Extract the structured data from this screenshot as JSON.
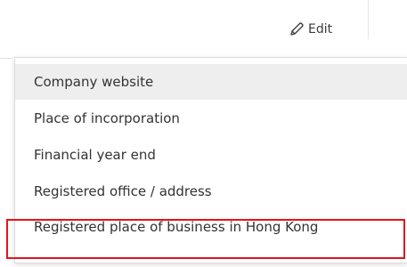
{
  "toolbar": {
    "edit_label": "Edit",
    "edit_icon": "pencil-icon"
  },
  "dropdown": {
    "options": [
      {
        "label": "Company website",
        "highlighted": true
      },
      {
        "label": "Place of incorporation",
        "highlighted": false
      },
      {
        "label": "Financial year end",
        "highlighted": false
      },
      {
        "label": "Registered office / address",
        "highlighted": false
      },
      {
        "label": "Registered place of business in Hong Kong",
        "highlighted": false,
        "annotated": true
      }
    ]
  },
  "colors": {
    "highlight_bg": "#eeeeee",
    "annotation_border": "#e3141b",
    "text": "#333333"
  }
}
